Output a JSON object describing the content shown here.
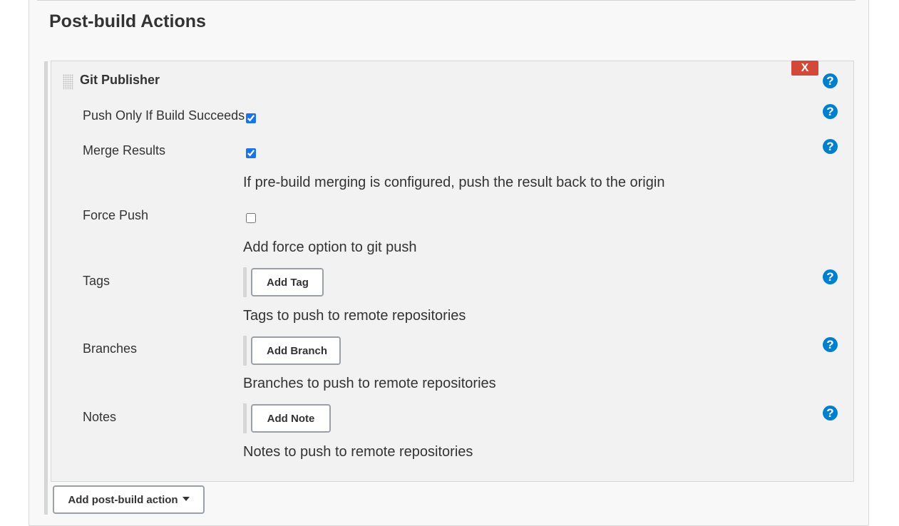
{
  "section": {
    "title": "Post-build Actions"
  },
  "publisher": {
    "title": "Git Publisher",
    "delete_label": "X",
    "help_symbol": "?",
    "fields": {
      "push_only_if_build_succeeds": {
        "label": "Push Only If Build Succeeds",
        "checked": true
      },
      "merge_results": {
        "label": "Merge Results",
        "checked": true,
        "description": "If pre-build merging is configured, push the result back to the origin"
      },
      "force_push": {
        "label": "Force Push",
        "checked": false,
        "description": "Add force option to git push"
      },
      "tags": {
        "label": "Tags",
        "button": "Add Tag",
        "description": "Tags to push to remote repositories"
      },
      "branches": {
        "label": "Branches",
        "button": "Add Branch",
        "description": "Branches to push to remote repositories"
      },
      "notes": {
        "label": "Notes",
        "button": "Add Note",
        "description": "Notes to push to remote repositories"
      }
    }
  },
  "footer": {
    "add_post_build_action": "Add post-build action"
  },
  "icons": {
    "help": "help-icon",
    "dropdown": "chevron-down-icon",
    "drag": "drag-handle-icon"
  },
  "colors": {
    "help_icon": "#0080cc",
    "delete_button": "#d24939",
    "checkbox": "#1a73e8"
  }
}
